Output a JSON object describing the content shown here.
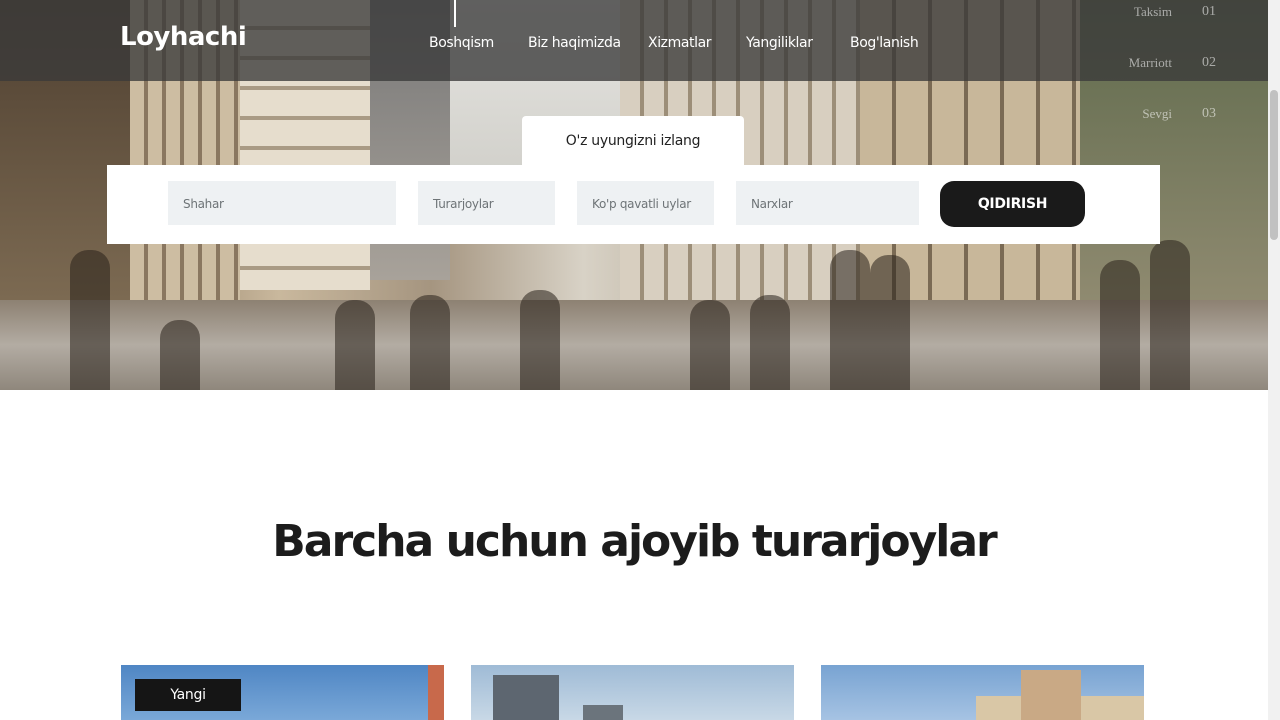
{
  "header": {
    "logo": "Loyhachi",
    "nav": [
      "Boshqism",
      "Biz haqimizda",
      "Xizmatlar",
      "Yangiliklar",
      "Bog'lanish"
    ]
  },
  "slider": {
    "items": [
      {
        "label": "Taksim",
        "num": "01"
      },
      {
        "label": "Marriott",
        "num": "02"
      },
      {
        "label": "Sevgi",
        "num": "03"
      }
    ]
  },
  "search": {
    "tab_label": "O'z uyungizni izlang",
    "fields": [
      "Shahar",
      "Turarjoylar",
      "Ko'p qavatli uylar",
      "Narxlar"
    ],
    "button": "QIDIRISH"
  },
  "section": {
    "title": "Barcha uchun ajoyib turarjoylar"
  },
  "cards": [
    {
      "badge": "Yangi"
    },
    {},
    {}
  ],
  "colors": {
    "dark": "#1a1a1a",
    "field_bg": "#eef1f3",
    "navbar": "rgba(58,58,58,0.78)"
  }
}
